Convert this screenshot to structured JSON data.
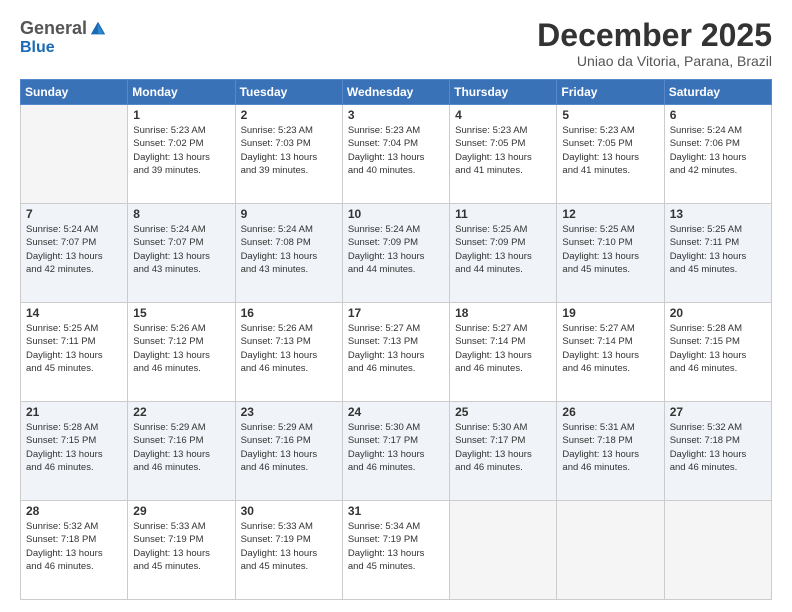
{
  "logo": {
    "general": "General",
    "blue": "Blue"
  },
  "header": {
    "month": "December 2025",
    "location": "Uniao da Vitoria, Parana, Brazil"
  },
  "weekdays": [
    "Sunday",
    "Monday",
    "Tuesday",
    "Wednesday",
    "Thursday",
    "Friday",
    "Saturday"
  ],
  "weeks": [
    [
      {
        "day": "",
        "empty": true
      },
      {
        "day": "1",
        "rise": "5:23 AM",
        "set": "7:02 PM",
        "daylight": "13 hours and 39 minutes."
      },
      {
        "day": "2",
        "rise": "5:23 AM",
        "set": "7:03 PM",
        "daylight": "13 hours and 39 minutes."
      },
      {
        "day": "3",
        "rise": "5:23 AM",
        "set": "7:04 PM",
        "daylight": "13 hours and 40 minutes."
      },
      {
        "day": "4",
        "rise": "5:23 AM",
        "set": "7:05 PM",
        "daylight": "13 hours and 41 minutes."
      },
      {
        "day": "5",
        "rise": "5:23 AM",
        "set": "7:05 PM",
        "daylight": "13 hours and 41 minutes."
      },
      {
        "day": "6",
        "rise": "5:24 AM",
        "set": "7:06 PM",
        "daylight": "13 hours and 42 minutes."
      }
    ],
    [
      {
        "day": "7",
        "rise": "5:24 AM",
        "set": "7:07 PM",
        "daylight": "13 hours and 42 minutes."
      },
      {
        "day": "8",
        "rise": "5:24 AM",
        "set": "7:07 PM",
        "daylight": "13 hours and 43 minutes."
      },
      {
        "day": "9",
        "rise": "5:24 AM",
        "set": "7:08 PM",
        "daylight": "13 hours and 43 minutes."
      },
      {
        "day": "10",
        "rise": "5:24 AM",
        "set": "7:09 PM",
        "daylight": "13 hours and 44 minutes."
      },
      {
        "day": "11",
        "rise": "5:25 AM",
        "set": "7:09 PM",
        "daylight": "13 hours and 44 minutes."
      },
      {
        "day": "12",
        "rise": "5:25 AM",
        "set": "7:10 PM",
        "daylight": "13 hours and 45 minutes."
      },
      {
        "day": "13",
        "rise": "5:25 AM",
        "set": "7:11 PM",
        "daylight": "13 hours and 45 minutes."
      }
    ],
    [
      {
        "day": "14",
        "rise": "5:25 AM",
        "set": "7:11 PM",
        "daylight": "13 hours and 45 minutes."
      },
      {
        "day": "15",
        "rise": "5:26 AM",
        "set": "7:12 PM",
        "daylight": "13 hours and 46 minutes."
      },
      {
        "day": "16",
        "rise": "5:26 AM",
        "set": "7:13 PM",
        "daylight": "13 hours and 46 minutes."
      },
      {
        "day": "17",
        "rise": "5:27 AM",
        "set": "7:13 PM",
        "daylight": "13 hours and 46 minutes."
      },
      {
        "day": "18",
        "rise": "5:27 AM",
        "set": "7:14 PM",
        "daylight": "13 hours and 46 minutes."
      },
      {
        "day": "19",
        "rise": "5:27 AM",
        "set": "7:14 PM",
        "daylight": "13 hours and 46 minutes."
      },
      {
        "day": "20",
        "rise": "5:28 AM",
        "set": "7:15 PM",
        "daylight": "13 hours and 46 minutes."
      }
    ],
    [
      {
        "day": "21",
        "rise": "5:28 AM",
        "set": "7:15 PM",
        "daylight": "13 hours and 46 minutes."
      },
      {
        "day": "22",
        "rise": "5:29 AM",
        "set": "7:16 PM",
        "daylight": "13 hours and 46 minutes."
      },
      {
        "day": "23",
        "rise": "5:29 AM",
        "set": "7:16 PM",
        "daylight": "13 hours and 46 minutes."
      },
      {
        "day": "24",
        "rise": "5:30 AM",
        "set": "7:17 PM",
        "daylight": "13 hours and 46 minutes."
      },
      {
        "day": "25",
        "rise": "5:30 AM",
        "set": "7:17 PM",
        "daylight": "13 hours and 46 minutes."
      },
      {
        "day": "26",
        "rise": "5:31 AM",
        "set": "7:18 PM",
        "daylight": "13 hours and 46 minutes."
      },
      {
        "day": "27",
        "rise": "5:32 AM",
        "set": "7:18 PM",
        "daylight": "13 hours and 46 minutes."
      }
    ],
    [
      {
        "day": "28",
        "rise": "5:32 AM",
        "set": "7:18 PM",
        "daylight": "13 hours and 46 minutes."
      },
      {
        "day": "29",
        "rise": "5:33 AM",
        "set": "7:19 PM",
        "daylight": "13 hours and 45 minutes."
      },
      {
        "day": "30",
        "rise": "5:33 AM",
        "set": "7:19 PM",
        "daylight": "13 hours and 45 minutes."
      },
      {
        "day": "31",
        "rise": "5:34 AM",
        "set": "7:19 PM",
        "daylight": "13 hours and 45 minutes."
      },
      {
        "day": "",
        "empty": true
      },
      {
        "day": "",
        "empty": true
      },
      {
        "day": "",
        "empty": true
      }
    ]
  ]
}
